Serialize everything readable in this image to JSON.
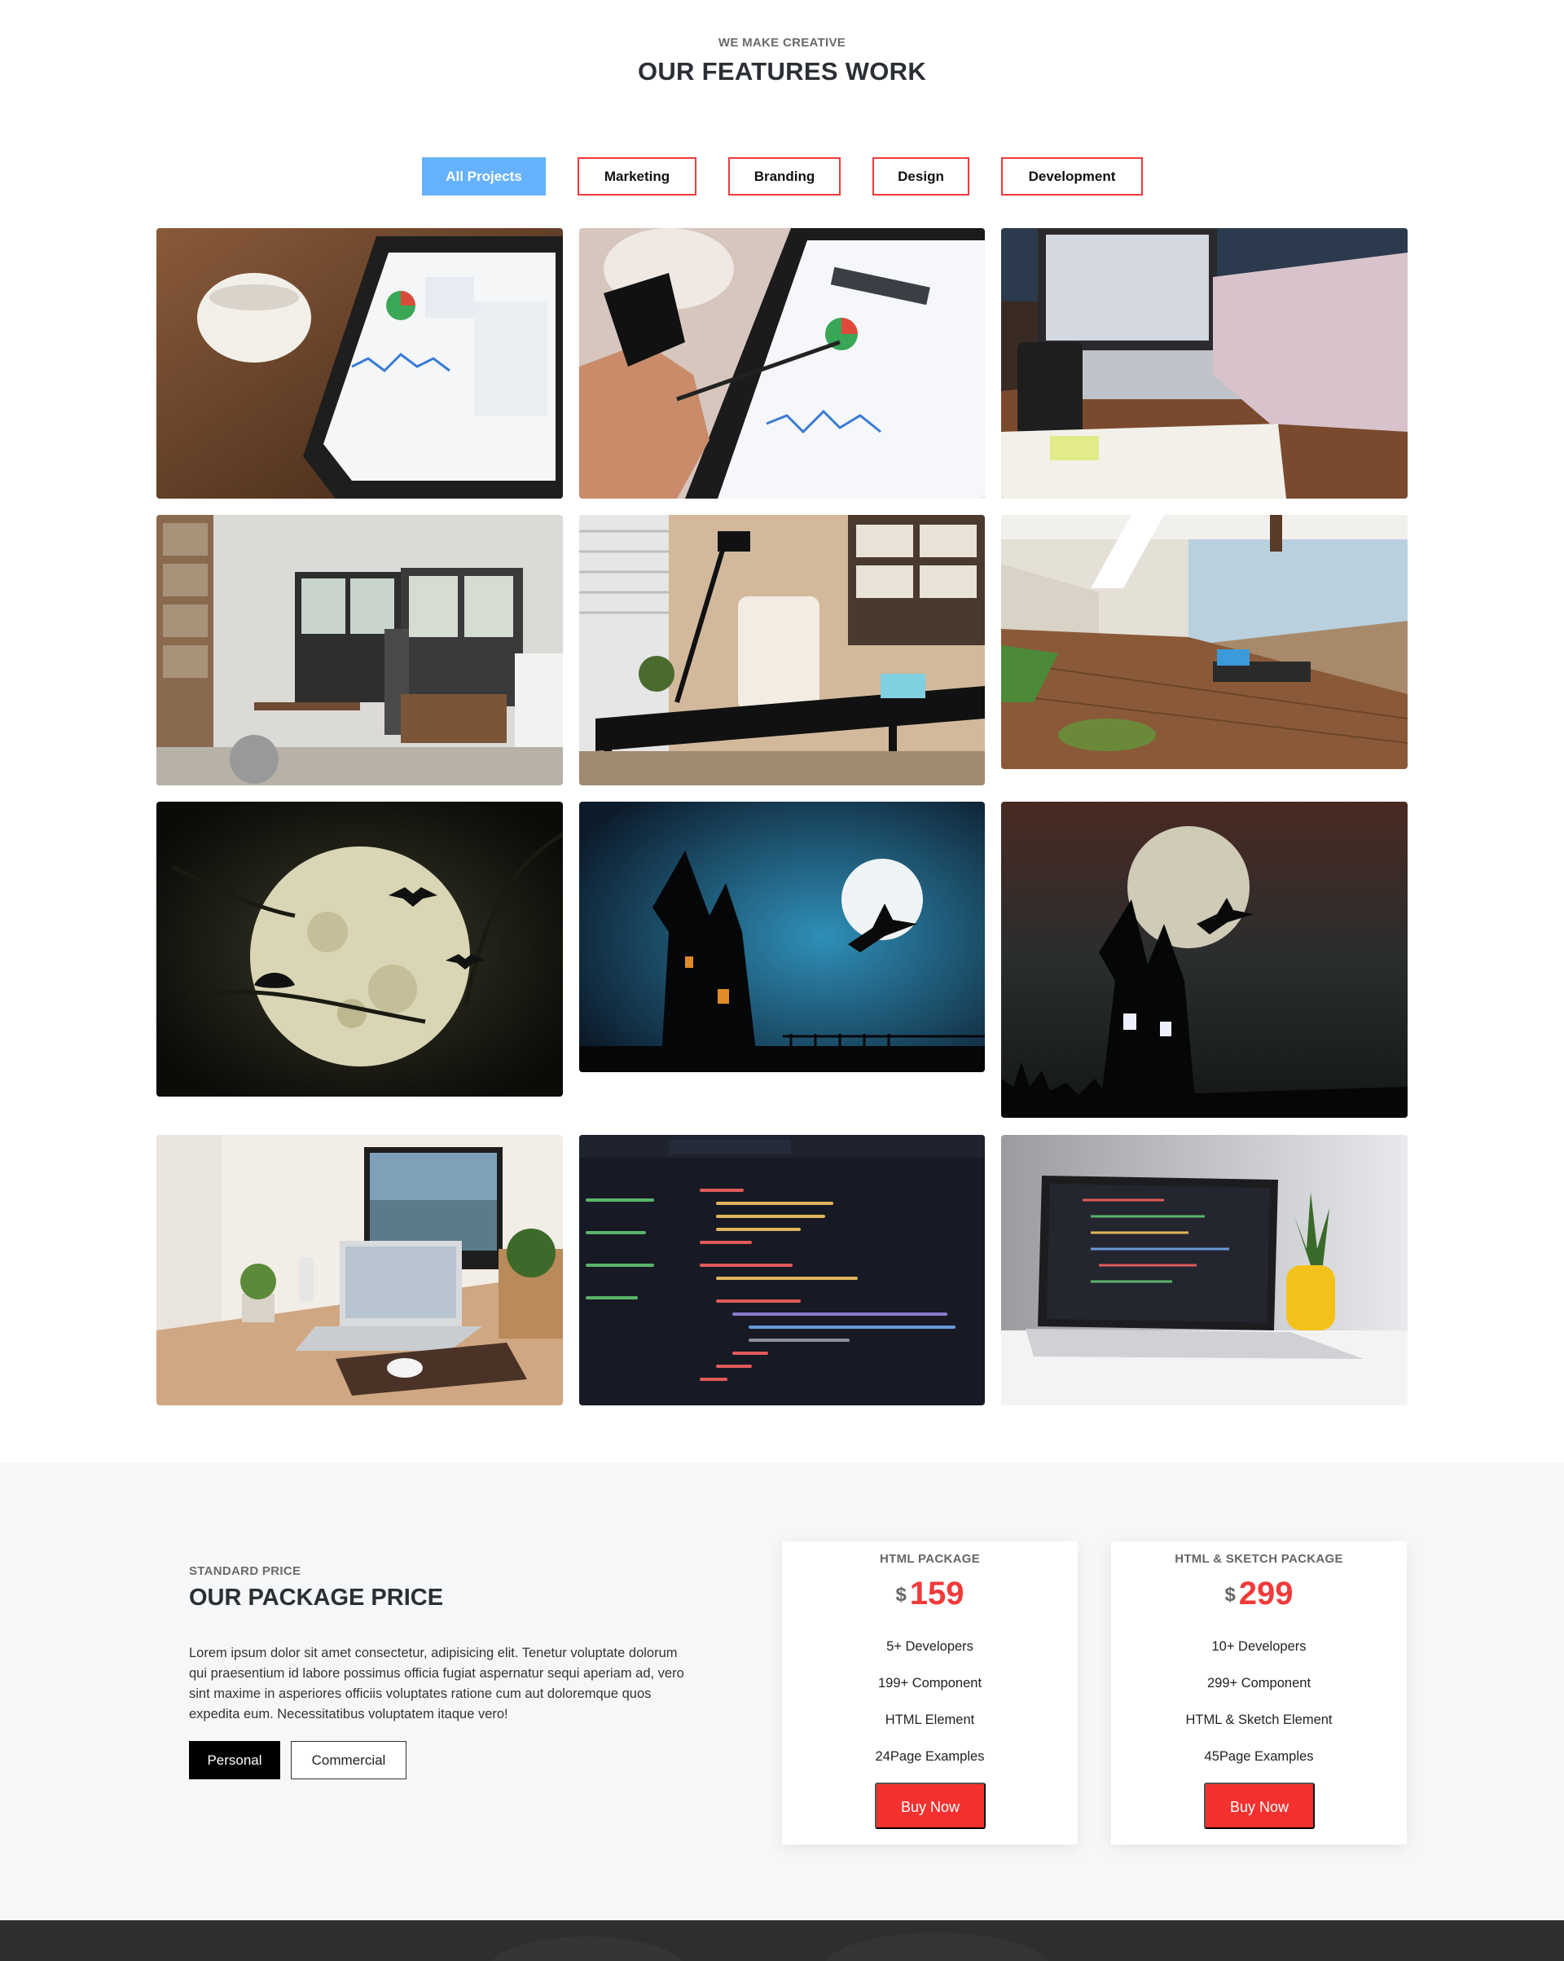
{
  "features": {
    "subtitle": "WE MAKE CREATIVE",
    "title": "OUR FEATURES WORK",
    "filters": [
      "All Projects",
      "Marketing",
      "Branding",
      "Design",
      "Development"
    ],
    "active_filter": "All Projects",
    "colors": {
      "accent_red": "#f03a3a",
      "active_blue": "#66b2ff"
    }
  },
  "pricing": {
    "subtitle": "STANDARD PRICE",
    "title": "OUR PACKAGE PRICE",
    "description": "Lorem ipsum dolor sit amet consectetur, adipisicing elit. Tenetur voluptate dolorum qui praesentium id labore possimus officia fugiat aspernatur sequi aperiam ad, vero sint maxime in asperiores officiis voluptates ratione cum aut doloremque quos expedita eum. Necessitatibus voluptatem itaque vero!",
    "toggle": {
      "personal": "Personal",
      "commercial": "Commercial",
      "selected": "Personal"
    },
    "packages": [
      {
        "name": "HTML PACKAGE",
        "currency": "$",
        "price": "159",
        "features": [
          "5+ Developers",
          "199+ Component",
          "HTML Element",
          "24Page Examples"
        ],
        "button": "Buy Now"
      },
      {
        "name": "HTML & SKETCH PACKAGE",
        "currency": "$",
        "price": "299",
        "features": [
          "10+ Developers",
          "299+ Component",
          "HTML & Sketch Element",
          "45Page Examples"
        ],
        "button": "Buy Now"
      }
    ]
  }
}
